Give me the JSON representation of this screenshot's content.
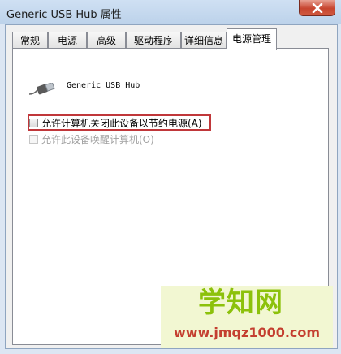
{
  "window": {
    "title": "Generic USB Hub 属性"
  },
  "tabs": [
    {
      "label": "常规"
    },
    {
      "label": "电源"
    },
    {
      "label": "高级"
    },
    {
      "label": "驱动程序"
    },
    {
      "label": "详细信息"
    },
    {
      "label": "电源管理",
      "active": true
    }
  ],
  "device": {
    "name": "Generic USB Hub",
    "icon": "usb-plug-icon"
  },
  "options": [
    {
      "label": "允许计算机关闭此设备以节约电源(A)",
      "checked": false,
      "enabled": true,
      "highlighted": true
    },
    {
      "label": "允许此设备唤醒计算机(O)",
      "checked": false,
      "enabled": false
    }
  ],
  "watermark": {
    "main": "学知网",
    "sub": "www.jmqz1000.com"
  },
  "colors": {
    "highlight_border": "#c0373a",
    "watermark_green": "#8cc10b",
    "watermark_red": "#c43f30"
  }
}
